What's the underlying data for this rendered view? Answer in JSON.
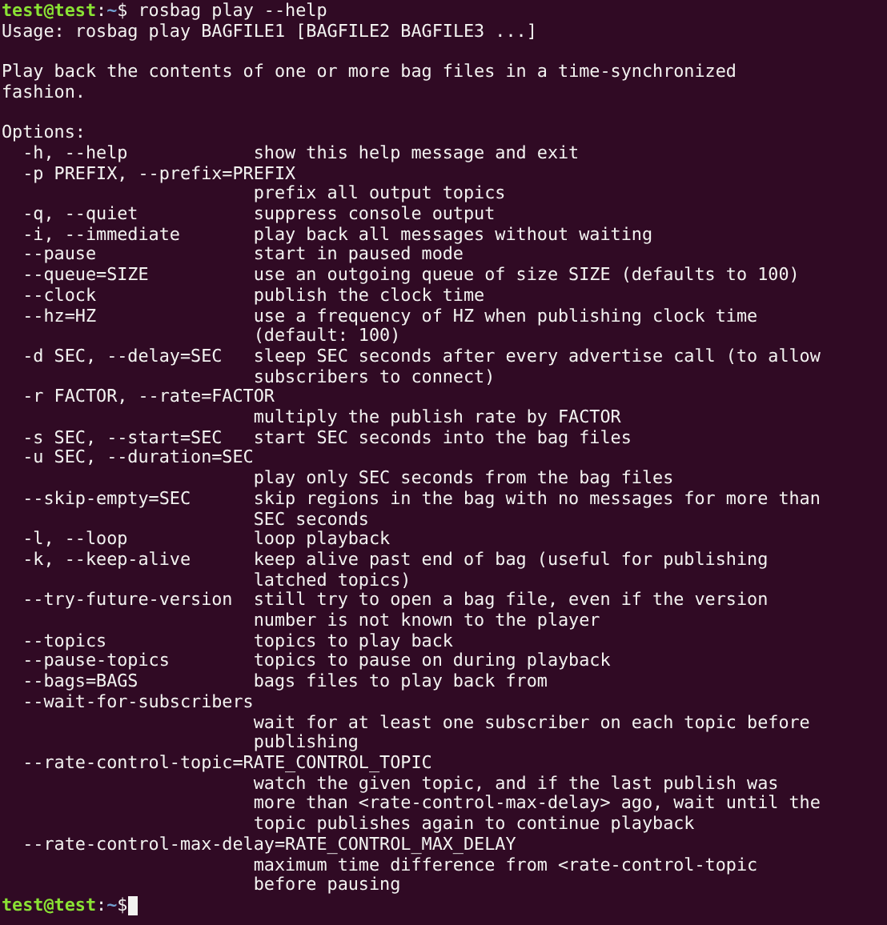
{
  "prompt": {
    "user_host": "test@test",
    "separator": ":",
    "path": "~",
    "symbol": "$",
    "command": "rosbag play --help"
  },
  "usage": "Usage: rosbag play BAGFILE1 [BAGFILE2 BAGFILE3 ...]",
  "description": [
    "Play back the contents of one or more bag files in a time-synchronized",
    "fashion."
  ],
  "options_heading": "Options:",
  "options": [
    {
      "flag": "-h, --help",
      "description": [
        "show this help message and exit"
      ]
    },
    {
      "flag": "-p PREFIX, --prefix=PREFIX",
      "description": [
        "prefix all output topics"
      ]
    },
    {
      "flag": "-q, --quiet",
      "description": [
        "suppress console output"
      ]
    },
    {
      "flag": "-i, --immediate",
      "description": [
        "play back all messages without waiting"
      ]
    },
    {
      "flag": "--pause",
      "description": [
        "start in paused mode"
      ]
    },
    {
      "flag": "--queue=SIZE",
      "description": [
        "use an outgoing queue of size SIZE (defaults to 100)"
      ]
    },
    {
      "flag": "--clock",
      "description": [
        "publish the clock time"
      ]
    },
    {
      "flag": "--hz=HZ",
      "description": [
        "use a frequency of HZ when publishing clock time",
        "(default: 100)"
      ]
    },
    {
      "flag": "-d SEC, --delay=SEC",
      "description": [
        "sleep SEC seconds after every advertise call (to allow",
        "subscribers to connect)"
      ]
    },
    {
      "flag": "-r FACTOR, --rate=FACTOR",
      "description": [
        "multiply the publish rate by FACTOR"
      ]
    },
    {
      "flag": "-s SEC, --start=SEC",
      "description": [
        "start SEC seconds into the bag files"
      ]
    },
    {
      "flag": "-u SEC, --duration=SEC",
      "description": [
        "play only SEC seconds from the bag files"
      ]
    },
    {
      "flag": "--skip-empty=SEC",
      "description": [
        "skip regions in the bag with no messages for more than",
        "SEC seconds"
      ]
    },
    {
      "flag": "-l, --loop",
      "description": [
        "loop playback"
      ]
    },
    {
      "flag": "-k, --keep-alive",
      "description": [
        "keep alive past end of bag (useful for publishing",
        "latched topics)"
      ]
    },
    {
      "flag": "--try-future-version",
      "description": [
        "still try to open a bag file, even if the version",
        "number is not known to the player"
      ]
    },
    {
      "flag": "--topics",
      "description": [
        "topics to play back"
      ]
    },
    {
      "flag": "--pause-topics",
      "description": [
        "topics to pause on during playback"
      ]
    },
    {
      "flag": "--bags=BAGS",
      "description": [
        "bags files to play back from"
      ]
    },
    {
      "flag": "--wait-for-subscribers",
      "description": [
        "wait for at least one subscriber on each topic before",
        "publishing"
      ]
    },
    {
      "flag": "--rate-control-topic=RATE_CONTROL_TOPIC",
      "description": [
        "watch the given topic, and if the last publish was",
        "more than <rate-control-max-delay> ago, wait until the",
        "topic publishes again to continue playback"
      ]
    },
    {
      "flag": "--rate-control-max-delay=RATE_CONTROL_MAX_DELAY",
      "description": [
        "maximum time difference from <rate-control-topic",
        "before pausing"
      ]
    }
  ],
  "final_prompt": {
    "user_host": "test@test",
    "separator": ":",
    "path": "~",
    "symbol": "$"
  }
}
